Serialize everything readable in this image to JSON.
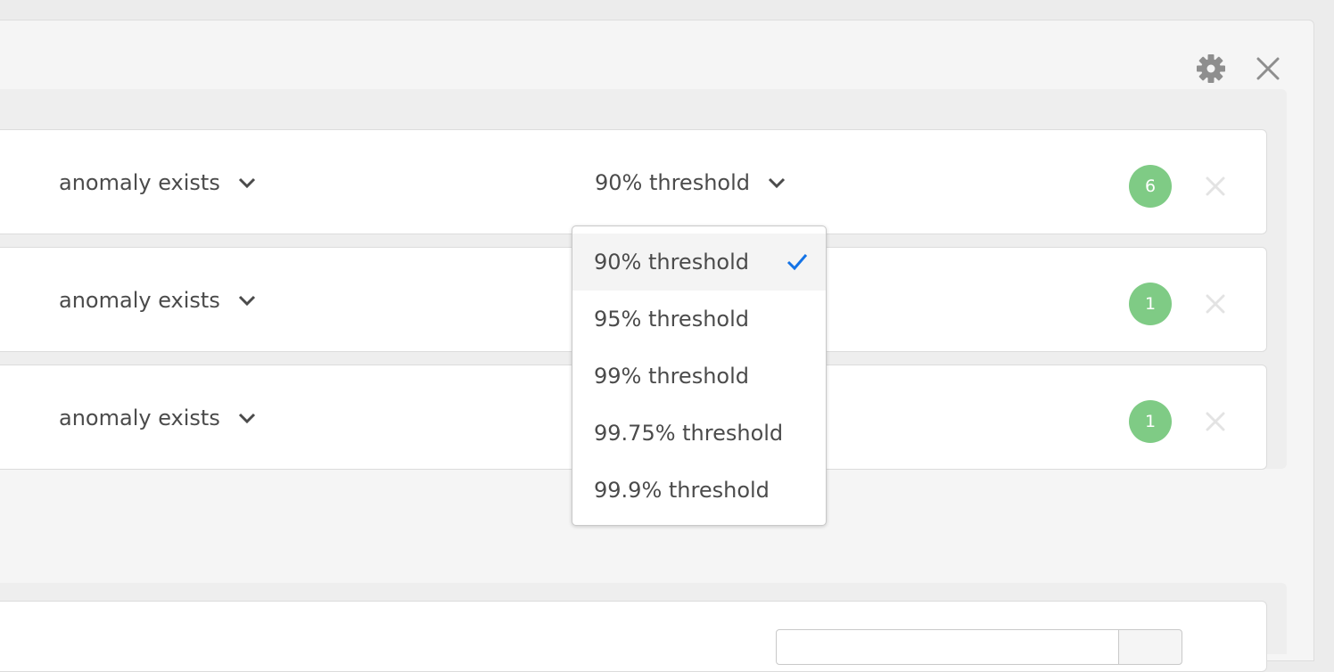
{
  "header": {
    "settings_icon": "gear-icon",
    "close_icon": "close-icon"
  },
  "rules": [
    {
      "condition": "anomaly exists",
      "threshold": "90% threshold",
      "count": "6"
    },
    {
      "condition": "anomaly exists",
      "threshold": "",
      "count": "1"
    },
    {
      "condition": "anomaly exists",
      "threshold": "",
      "count": "1"
    }
  ],
  "threshold_dropdown": {
    "selected": "90% threshold",
    "options": [
      "90% threshold",
      "95% threshold",
      "99% threshold",
      "99.75% threshold",
      "99.9% threshold"
    ]
  },
  "colors": {
    "badge": "#7fcb85",
    "check": "#1473e6",
    "panel": "#f5f5f5"
  }
}
